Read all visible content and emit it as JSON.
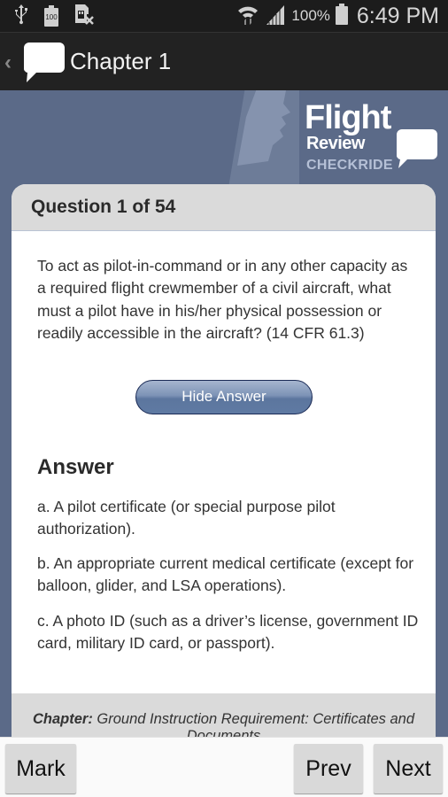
{
  "status_bar": {
    "left_icons": [
      "usb-icon",
      "battery-100-icon",
      "sim-blocked-icon"
    ],
    "battery_small_label": "100",
    "right_icons": [
      "wifi-icon",
      "signal-icon",
      "battery-icon"
    ],
    "battery_percent": "100%",
    "time": "6:49 PM"
  },
  "action_bar": {
    "back_icon": "chevron-left-icon",
    "app_icon": "speech-bubble-icon",
    "title": "Chapter 1"
  },
  "branding": {
    "flight": "Flight",
    "review": "Review",
    "checkride": "CHECKRIDE"
  },
  "question": {
    "counter": "Question 1 of 54",
    "text": "To act as pilot-in-command or in any other capacity as a required flight crewmember of a civil aircraft, what must a pilot have in his/her physical possession or readily accessible in the aircraft? (14 CFR 61.3)",
    "toggle_label": "Hide Answer"
  },
  "answer": {
    "title": "Answer",
    "items": [
      "a. A pilot certificate (or special purpose pilot authorization).",
      "b. An appropriate current medical certificate (except for balloon, glider, and LSA operations).",
      "c. A photo ID (such as a driver’s license, government ID card, military ID card, or passport)."
    ]
  },
  "footer": {
    "chapter_label": "Chapter:",
    "chapter_name": "Ground Instruction Requirement: Certificates and Documents"
  },
  "nav": {
    "mark": "Mark",
    "prev": "Prev",
    "next": "Next"
  },
  "colors": {
    "background": "#5b6a88",
    "action_bar": "#222222",
    "card_header": "#dadada",
    "button_gradient_top": "#a6b5cf",
    "button_gradient_bottom": "#5f7aa3"
  }
}
